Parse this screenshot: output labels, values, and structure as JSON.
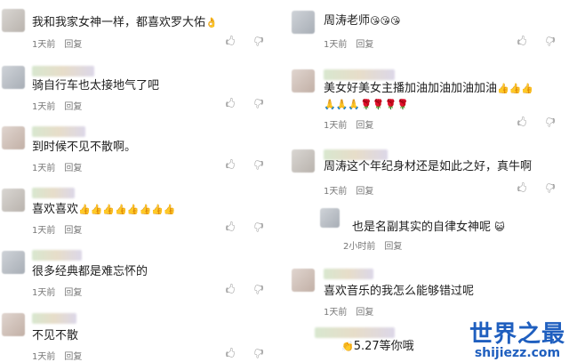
{
  "left_comments": [
    {
      "text": "我和我家女神一样，都喜欢罗大佑",
      "emoji": "👌",
      "time": "1天前",
      "reply": "回复"
    },
    {
      "text": "骑自行车也太接地气了吧",
      "emoji": "",
      "time": "1天前",
      "reply": "回复"
    },
    {
      "text": "到时候不见不散啊。",
      "emoji": "",
      "time": "1天前",
      "reply": "回复"
    },
    {
      "text": "喜欢喜欢",
      "emoji": "👍👍👍👍👍👍👍👍",
      "time": "1天前",
      "reply": "回复"
    },
    {
      "text": "很多经典都是难忘怀的",
      "emoji": "",
      "time": "1天前",
      "reply": "回复"
    },
    {
      "text": "不见不散",
      "emoji": "",
      "time": "1天前",
      "reply": "回复"
    }
  ],
  "right_comments": [
    {
      "text": "周涛老师",
      "emoji": "😘😘😘",
      "time": "1天前",
      "reply": "回复"
    },
    {
      "text": "美女好美女主播加油加油加油加油",
      "emoji": "👍👍👍",
      "line2": "🙏🙏🙏🌹🌹🌹🌹",
      "time": "1天前",
      "reply": "回复"
    },
    {
      "text": "周涛这个年纪身材还是如此之好，真牛啊",
      "emoji": "",
      "time": "1天前",
      "reply": "回复"
    },
    {
      "text": "喜欢音乐的我怎么能够错过呢",
      "emoji": "",
      "time": "1天前",
      "reply": "回复"
    },
    {
      "text": "5.27等你哦",
      "emoji": "👏",
      "time": "",
      "reply": ""
    }
  ],
  "sub_reply": {
    "text": "也是名副其实的自律女神呢",
    "emoji": "😺",
    "time": "2小时前",
    "reply": "回复"
  },
  "actions": {
    "like_icon": "thumb-up-icon",
    "dislike_icon": "thumb-down-icon",
    "like_glyph": "🖒",
    "dislike_glyph": "🖓"
  },
  "watermark": {
    "title": "世界之最",
    "url": "shijiezz.com",
    "color": "#1f5fbf"
  }
}
